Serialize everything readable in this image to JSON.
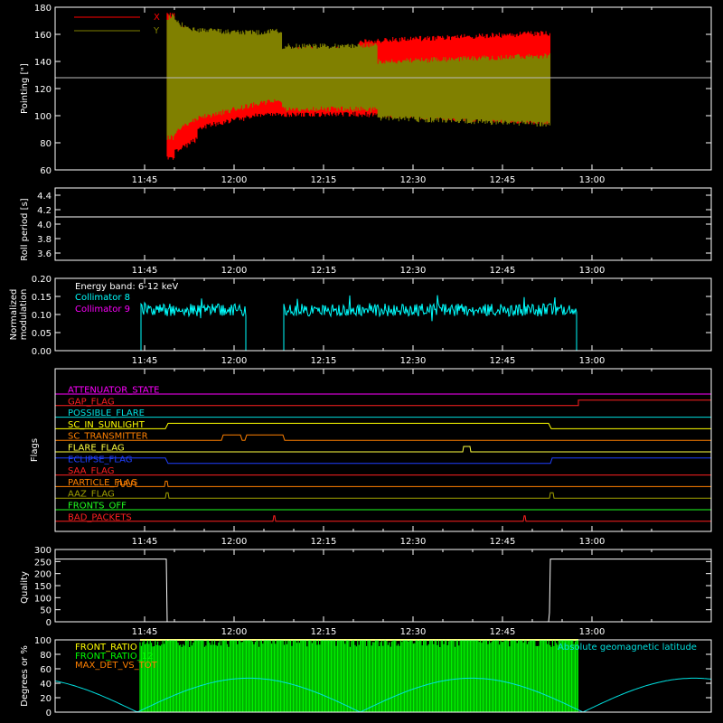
{
  "time_ticks": [
    "11:45",
    "12:00",
    "12:15",
    "12:30",
    "12:45",
    "13:00"
  ],
  "chart_data": [
    {
      "type": "line",
      "id": "pointing",
      "ylabel": "Pointing [\"]",
      "yticks": [
        "60",
        "80",
        "100",
        "120",
        "140",
        "160",
        "180"
      ],
      "ylim": [
        60,
        180
      ],
      "series": [
        {
          "name": "X",
          "color": "#ff0000"
        },
        {
          "name": "Y",
          "color": "#808000"
        }
      ],
      "reference_line": 128
    },
    {
      "type": "line",
      "id": "roll",
      "ylabel": "Roll period [s]",
      "yticks": [
        "3.6",
        "3.8",
        "4.0",
        "4.2",
        "4.4"
      ],
      "ylim": [
        3.5,
        4.5
      ],
      "value": 4.0
    },
    {
      "type": "line",
      "id": "modulation",
      "ylabel_line1": "Normalized",
      "ylabel_line2": "modulation",
      "yticks": [
        "0.00",
        "0.05",
        "0.10",
        "0.15",
        "0.20"
      ],
      "ylim": [
        0,
        0.2
      ],
      "annotation": "Energy band: 6-12 keV",
      "series": [
        {
          "name": "Collimator 8",
          "color": "#00ffff"
        },
        {
          "name": "Collimator 9",
          "color": "#ff00ff"
        }
      ]
    },
    {
      "type": "line",
      "id": "flags",
      "ylabel": "Flags",
      "flags": [
        {
          "name": "ATTENUATOR_STATE",
          "color": "#ff00ff"
        },
        {
          "name": "GAP_FLAG",
          "color": "#ff2020"
        },
        {
          "name": "POSSIBLE_FLARE",
          "color": "#00e0e0"
        },
        {
          "name": "SC_IN_SUNLIGHT",
          "color": "#ffff00"
        },
        {
          "name": "SC_TRANSMITTER",
          "color": "#ff8000"
        },
        {
          "name": "FLARE_FLAG",
          "color": "#ffff40"
        },
        {
          "name": "ECLIPSE_FLAG",
          "color": "#2040ff"
        },
        {
          "name": "SAA_FLAG",
          "color": "#ff2020"
        },
        {
          "name": "PARTICLE_FLAG",
          "color": "#ff8000"
        },
        {
          "name": "AAZ_FLAG",
          "color": "#a0a000"
        },
        {
          "name": "FRONTS_OFF",
          "color": "#20ff20"
        },
        {
          "name": "BAD_PACKETS",
          "color": "#ff2020"
        }
      ]
    },
    {
      "type": "line",
      "id": "quality",
      "ylabel": "Quality",
      "yticks": [
        "0",
        "50",
        "100",
        "150",
        "200",
        "250",
        "300"
      ],
      "ylim": [
        0,
        300
      ],
      "high_value": 260
    },
    {
      "type": "line",
      "id": "front",
      "ylabel": "Degrees or %",
      "yticks": [
        "0",
        "20",
        "40",
        "60",
        "80",
        "100"
      ],
      "ylim": [
        0,
        100
      ],
      "series": [
        {
          "name": "FRONT_RATIO",
          "color": "#ffff00"
        },
        {
          "name": "FRONT_RATIO_12",
          "color": "#00ff00"
        },
        {
          "name": "MAX_DET_VS_TOT",
          "color": "#ff8000"
        }
      ],
      "latitude_label": "Absolute geomagnetic latitude",
      "latitude_color": "#00e0e0"
    }
  ]
}
